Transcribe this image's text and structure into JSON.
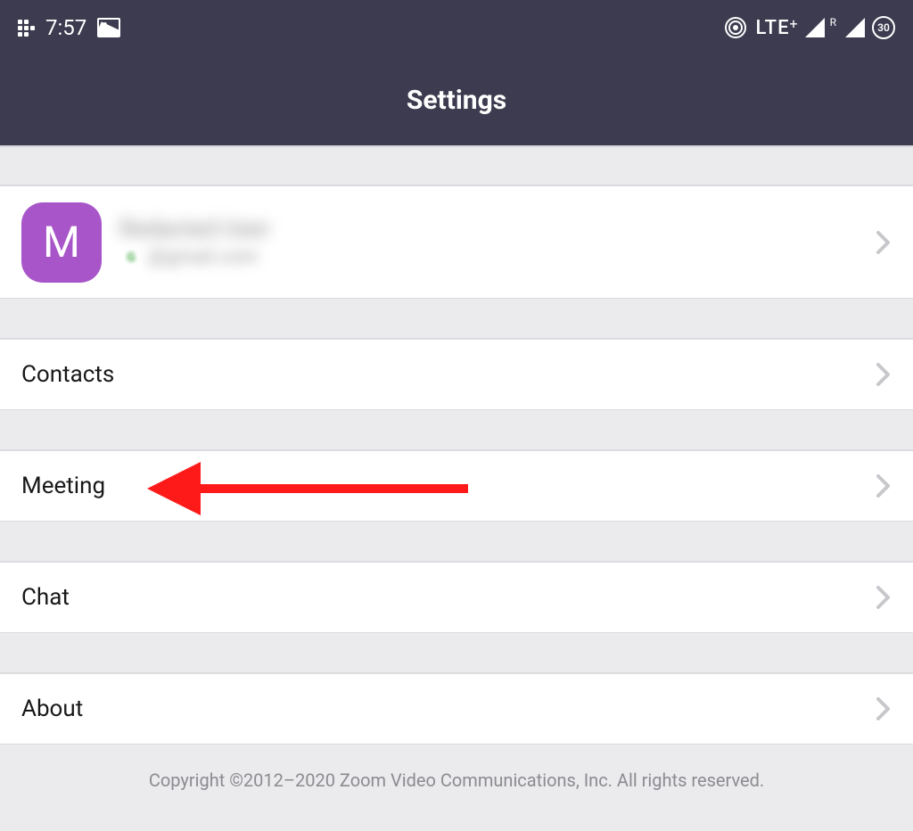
{
  "status": {
    "time": "7:57",
    "lte": "LTE",
    "lte_plus": "+",
    "roaming": "R",
    "badge": "30"
  },
  "header": {
    "title": "Settings"
  },
  "profile": {
    "initial": "M",
    "name": "Redacted User",
    "email_domain": "@gmail.com"
  },
  "menu": {
    "contacts": "Contacts",
    "meeting": "Meeting",
    "chat": "Chat",
    "about": "About"
  },
  "footer": {
    "copyright": "Copyright ©2012–2020 Zoom Video Communications, Inc. All rights reserved."
  }
}
